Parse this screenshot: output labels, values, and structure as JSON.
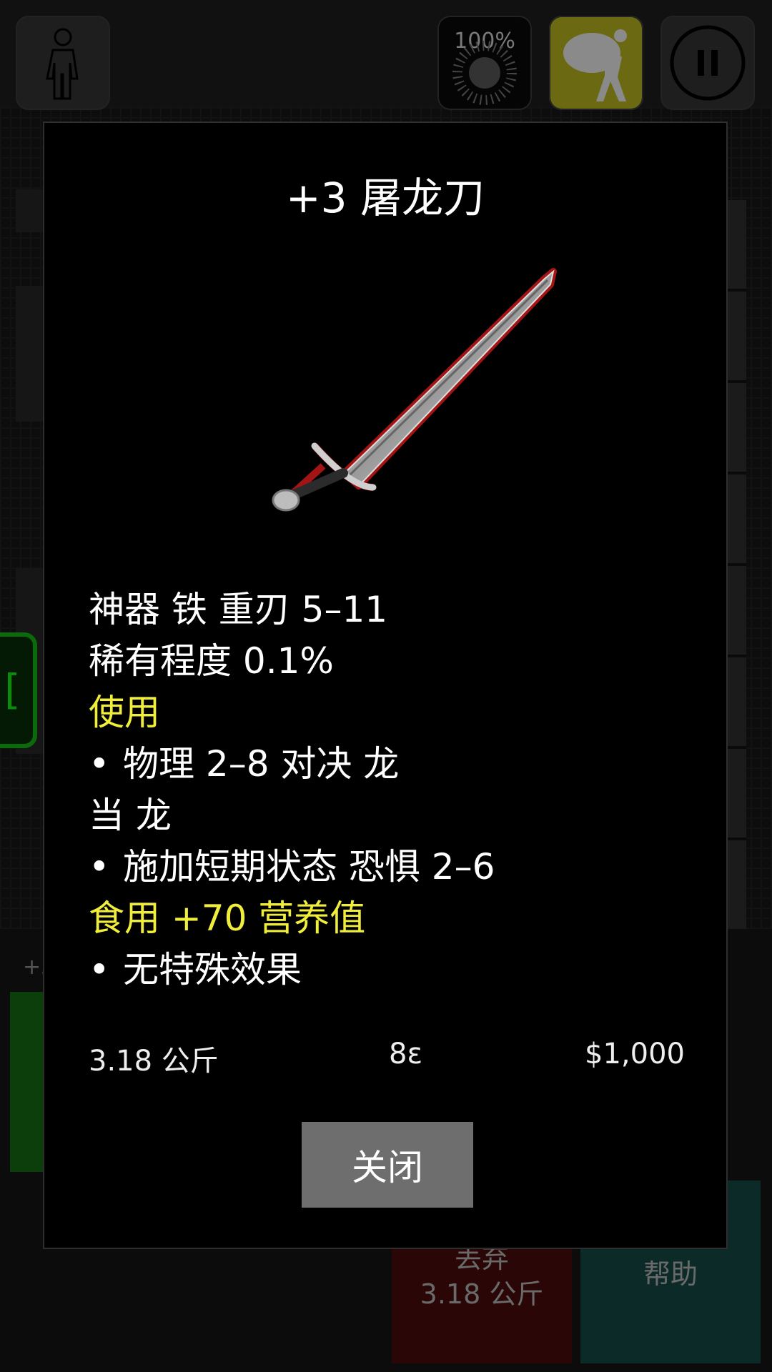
{
  "topbar": {
    "meter_label": "100%",
    "icons": [
      "person-icon",
      "meter-icon",
      "sack-carrier-icon",
      "pause-icon"
    ]
  },
  "background": {
    "bottom_item_label": "+3",
    "drop_button": {
      "line1": "丢弃",
      "line2": "3.18 公斤"
    },
    "help_button": {
      "label": "帮助"
    }
  },
  "modal": {
    "title": "+3 屠龙刀",
    "lines": [
      {
        "text": "神器 铁 重刃 5–11",
        "style": "normal",
        "bullet": false
      },
      {
        "text": "稀有程度 0.1%",
        "style": "normal",
        "bullet": false
      },
      {
        "text": "使用",
        "style": "yellow",
        "bullet": false
      },
      {
        "text": "物理 2–8 对决 龙",
        "style": "normal",
        "bullet": true
      },
      {
        "text": "当 龙",
        "style": "normal",
        "bullet": false
      },
      {
        "text": "施加短期状态 恐惧 2–6",
        "style": "normal",
        "bullet": true
      },
      {
        "text": "食用 +70 营养值",
        "style": "yellow",
        "bullet": false
      },
      {
        "text": "无特殊效果",
        "style": "normal",
        "bullet": true
      }
    ],
    "bullet_char": "•",
    "weight": "3.18 公斤",
    "value": "8ε",
    "price": "$1,000",
    "close_label": "关闭"
  },
  "colors": {
    "highlight_yellow": "#f0ee3a",
    "inventory_button": "#6b6a12",
    "close_button": "#6e6e6e"
  }
}
